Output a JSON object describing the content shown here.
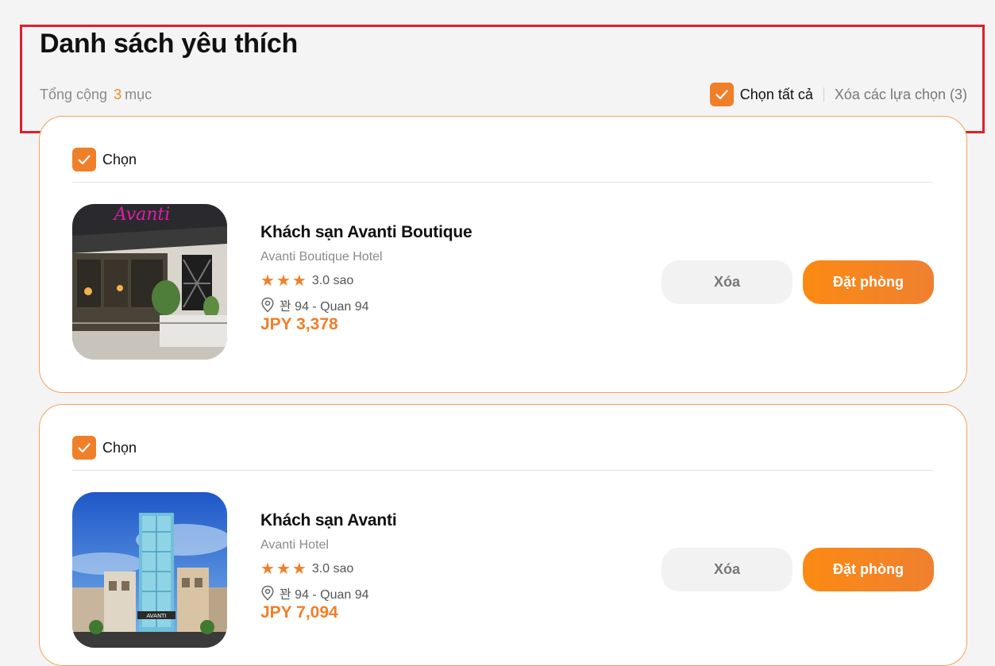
{
  "header": {
    "title": "Danh sách yêu thích",
    "summary_prefix": "Tổng cộng",
    "summary_count": "3",
    "summary_suffix": "mục",
    "select_all_label": "Chọn tất cả",
    "clear_selection_label": "Xóa các lựa chọn (3)"
  },
  "colors": {
    "accent": "#f07f2a",
    "highlight_border": "#e01f2a",
    "card_border": "#f0a55c"
  },
  "items": [
    {
      "select_label": "Chọn",
      "checked": true,
      "name": "Khách sạn Avanti Boutique",
      "subname": "Avanti Boutique Hotel",
      "stars": 3,
      "rating_text": "3.0 sao",
      "location": "꽌 94 - Quan 94",
      "price": "JPY 3,378",
      "delete_label": "Xóa",
      "book_label": "Đặt phòng",
      "image_text": "Avanti"
    },
    {
      "select_label": "Chọn",
      "checked": true,
      "name": "Khách sạn Avanti",
      "subname": "Avanti Hotel",
      "stars": 3,
      "rating_text": "3.0 sao",
      "location": "꽌 94 - Quan 94",
      "price": "JPY 7,094",
      "delete_label": "Xóa",
      "book_label": "Đặt phòng",
      "image_text": "AVANTI"
    }
  ],
  "icons": {
    "checkbox": "check-icon",
    "star": "star-icon",
    "location": "map-pin-icon"
  }
}
